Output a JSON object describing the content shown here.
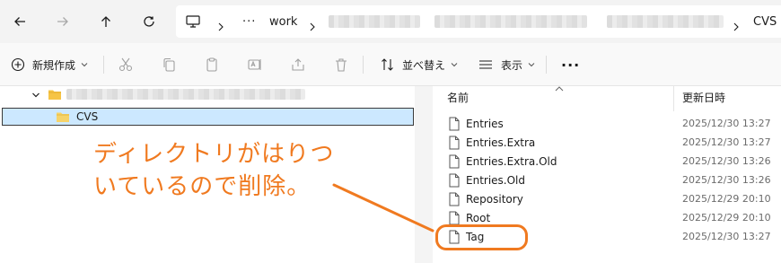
{
  "address": {
    "crumbs": [
      "work",
      "CVS"
    ],
    "ellipsis": "···"
  },
  "toolbar": {
    "new_label": "新規作成",
    "sort_label": "並べ替え",
    "view_label": "表示",
    "more_label": "···"
  },
  "tree": {
    "selected_label": "CVS"
  },
  "list": {
    "col_name": "名前",
    "col_date": "更新日時",
    "files": [
      {
        "name": "Entries",
        "date": "2025/12/30 13:27"
      },
      {
        "name": "Entries.Extra",
        "date": "2025/12/30 13:27"
      },
      {
        "name": "Entries.Extra.Old",
        "date": "2025/12/30 13:26"
      },
      {
        "name": "Entries.Old",
        "date": "2025/12/30 13:26"
      },
      {
        "name": "Repository",
        "date": "2025/12/29 20:10"
      },
      {
        "name": "Root",
        "date": "2025/12/29 20:10"
      },
      {
        "name": "Tag",
        "date": "2025/12/30 13:27"
      }
    ]
  },
  "annotation": {
    "line1": "ディレクトリがはりつ",
    "line2": "いているので削除。",
    "color": "#f07a20"
  },
  "colors": {
    "selection": "#cce8ff",
    "folder": "#f6c445"
  }
}
